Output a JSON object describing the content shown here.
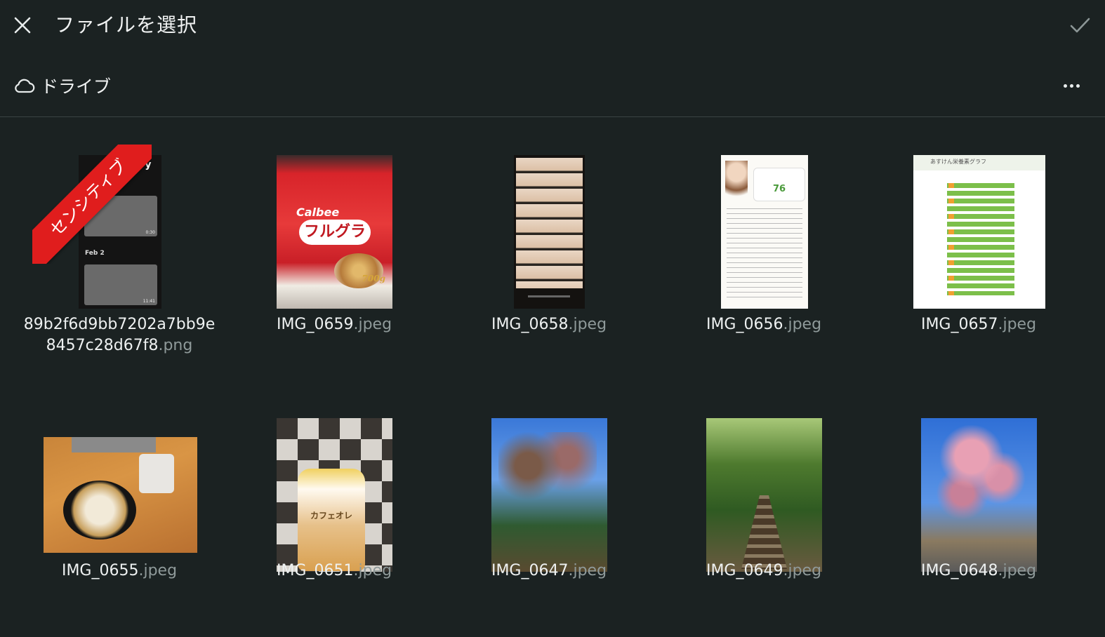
{
  "header": {
    "title": "ファイルを選択"
  },
  "drive": {
    "label": "ドライブ"
  },
  "files": [
    {
      "stem": "89b2f6d9bb7202a7bb9e",
      "stem2": "8457c28d67f8",
      "ext": ".png",
      "sensitive_label": "センシティブ",
      "thumb_title": "history",
      "thumb_date1": "ay",
      "thumb_date2": "Feb 2",
      "thumb_dur1": "0:30",
      "thumb_dur2": "11:41"
    },
    {
      "stem": "IMG_0659",
      "ext": ".jpeg",
      "thumb_brand": "Calbee",
      "thumb_product": "フルグラ",
      "thumb_weight": "700g"
    },
    {
      "stem": "IMG_0658",
      "ext": ".jpeg"
    },
    {
      "stem": "IMG_0656",
      "ext": ".jpeg",
      "thumb_score": "76"
    },
    {
      "stem": "IMG_0657",
      "ext": ".jpeg",
      "thumb_title": "あすけん栄養素グラフ"
    },
    {
      "stem": "IMG_0655",
      "ext": ".jpeg"
    },
    {
      "stem": "IMG_0651",
      "ext": ".jpeg",
      "thumb_product": "カフェオレ"
    },
    {
      "stem": "IMG_0647",
      "ext": ".jpeg"
    },
    {
      "stem": "IMG_0649",
      "ext": ".jpeg"
    },
    {
      "stem": "IMG_0648",
      "ext": ".jpeg"
    }
  ],
  "colors": {
    "background": "#1b2222",
    "divider": "#3a4444",
    "sensitive_ribbon": "#e01d1d",
    "extension_text": "#8f9a9a"
  },
  "icons": {
    "close": "close-icon",
    "confirm": "checkmark-icon",
    "drive": "cloud-icon",
    "more": "more-horizontal-icon"
  }
}
